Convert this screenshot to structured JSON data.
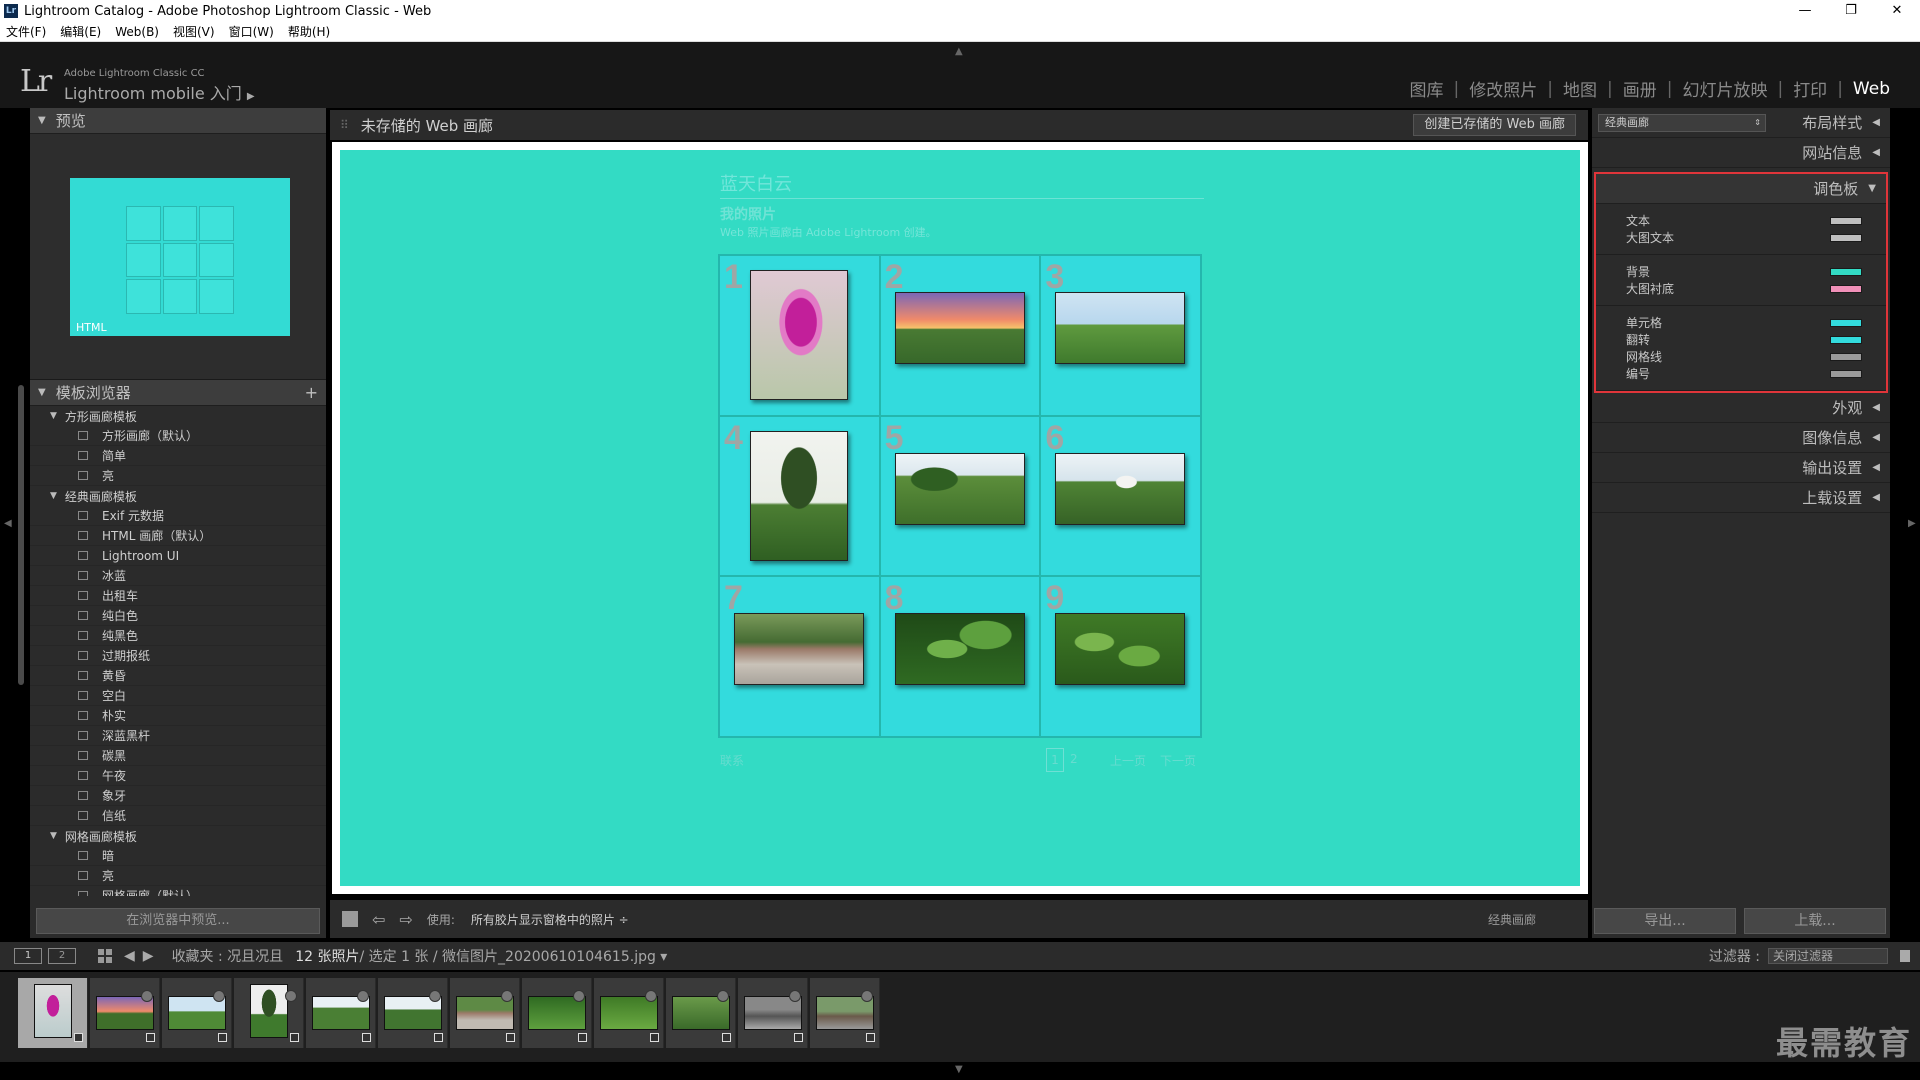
{
  "window": {
    "title": "Lightroom Catalog - Adobe Photoshop Lightroom Classic - Web",
    "app_icon": "Lr",
    "controls": [
      "—",
      "❐",
      "✕"
    ]
  },
  "menu": [
    "文件(F)",
    "编辑(E)",
    "Web(B)",
    "视图(V)",
    "窗口(W)",
    "帮助(H)"
  ],
  "identity": {
    "logo": "Lr",
    "product": "Adobe Lightroom Classic CC",
    "mobile": "Lightroom mobile 入门",
    "mobile_arrow": "▶"
  },
  "modules": [
    {
      "label": "图库",
      "active": false
    },
    {
      "label": "修改照片",
      "active": false
    },
    {
      "label": "地图",
      "active": false
    },
    {
      "label": "画册",
      "active": false
    },
    {
      "label": "幻灯片放映",
      "active": false
    },
    {
      "label": "打印",
      "active": false
    },
    {
      "label": "Web",
      "active": true
    }
  ],
  "left_panel": {
    "preview_title": "预览",
    "preview_label": "HTML",
    "template_browser_title": "模板浏览器",
    "template_browser_add": "+",
    "folders": [
      {
        "name": "方形画廊模板",
        "items": [
          "方形画廊（默认）",
          "简单",
          "亮"
        ]
      },
      {
        "name": "经典画廊模板",
        "items": [
          "Exif 元数据",
          "HTML 画廊（默认）",
          "Lightroom UI",
          "冰蓝",
          "出租车",
          "纯白色",
          "纯黑色",
          "过期报纸",
          "黄昏",
          "空白",
          "朴实",
          "深蓝黑杆",
          "碳黑",
          "午夜",
          "象牙",
          "信纸"
        ]
      },
      {
        "name": "网格画廊模板",
        "items": [
          "暗",
          "亮",
          "网格画廊（默认）"
        ]
      }
    ],
    "preview_in_browser": "在浏览器中预览..."
  },
  "center": {
    "gallery_name": "未存储的 Web 画廊",
    "create_saved": "创建已存储的 Web 画廊",
    "site_title": "蓝天白云",
    "collection_title": "我的照片",
    "collection_desc": "Web 照片画廊由 Adobe Lightroom 创建。",
    "cells": [
      "1",
      "2",
      "3",
      "4",
      "5",
      "6",
      "7",
      "8",
      "9"
    ],
    "contact": "联系",
    "page_1": "1",
    "page_2": "2",
    "prev": "上一页",
    "next": "下一页"
  },
  "toolbar": {
    "prev_arrow": "⇦",
    "next_arrow": "⇨",
    "use_label": "使用:",
    "use_value": "所有胶片显示窗格中的照片 ÷",
    "template": "经典画廊"
  },
  "right_panel": {
    "layout_select": "经典画廊",
    "layout_select_spin": "⇕",
    "layout_style": "布局样式",
    "site_info": "网站信息",
    "palette": "调色板",
    "appearance": "外观",
    "image_info": "图像信息",
    "output": "输出设置",
    "upload_settings": "上载设置",
    "color_groups": [
      [
        {
          "label": "文本",
          "color": "#bfbfbf"
        },
        {
          "label": "大图文本",
          "color": "#bfbfbf"
        }
      ],
      [
        {
          "label": "背景",
          "color": "#33dbc4"
        },
        {
          "label": "大图衬底",
          "color": "#f090b8"
        }
      ],
      [
        {
          "label": "单元格",
          "color": "#33dbdd"
        },
        {
          "label": "翻转",
          "color": "#33dbdd"
        },
        {
          "label": "网格线",
          "color": "#9a9a9a"
        },
        {
          "label": "编号",
          "color": "#9a9a9a"
        }
      ]
    ],
    "export": "导出...",
    "upload": "上载..."
  },
  "filmstrip_bar": {
    "screen1": "1",
    "screen2": "2",
    "back_arrow": "◀",
    "forward_arrow": "▶",
    "source": "收藏夹 : 况且况且",
    "count": "12 张照片",
    "selection": " / 选定 1 张 / 微信图片_20200610104615.jpg ▾",
    "filter_label": "过滤器 :",
    "filter_value": "关闭过滤器"
  },
  "watermark": "最需教育",
  "colors": {
    "gallery_bg": "#33dbc4",
    "cell_bg": "#33dbdd",
    "highlight": "#e0353a"
  }
}
